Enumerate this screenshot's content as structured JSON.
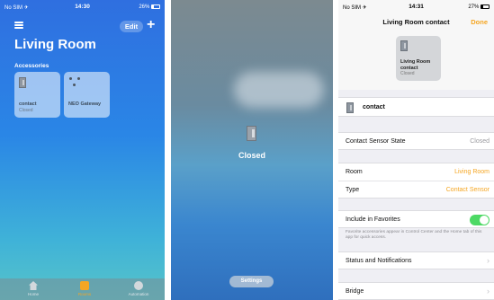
{
  "left": {
    "status": {
      "carrier": "No SIM ✈",
      "time": "14:30",
      "battery": "26%",
      "battery_level": 0.26
    },
    "edit_label": "Edit",
    "plus_label": "+",
    "room_title": "Living Room",
    "section_label": "Accessories",
    "tiles": [
      {
        "name": "contact",
        "state": "Closed"
      },
      {
        "name": "NEO Gateway",
        "state": ""
      }
    ],
    "tabs": [
      {
        "label": "Home",
        "icon": "house-icon"
      },
      {
        "label": "Rooms",
        "icon": "rooms-icon"
      },
      {
        "label": "Automation",
        "icon": "automation-icon"
      }
    ]
  },
  "middle": {
    "state": "Closed",
    "settings_label": "Settings"
  },
  "right": {
    "status": {
      "carrier": "No SIM ✈",
      "time": "14:31",
      "battery": "27%",
      "battery_level": 0.27
    },
    "nav_title": "Living Room contact",
    "done_label": "Done",
    "hero": {
      "name": "Living Room contact",
      "state": "Closed"
    },
    "accessory_name": "contact",
    "rows": {
      "sensor_state": {
        "label": "Contact Sensor State",
        "value": "Closed"
      },
      "room": {
        "label": "Room",
        "value": "Living Room"
      },
      "type": {
        "label": "Type",
        "value": "Contact Sensor"
      },
      "favorites": {
        "label": "Include in Favorites",
        "on": true
      },
      "favorites_note": "Favorite accessories appear in Control Center and the Home tab of this app for quick access.",
      "status": {
        "label": "Status and Notifications"
      },
      "bridge": {
        "label": "Bridge"
      }
    },
    "accent_color": "#f5a623",
    "toggle_color": "#4cd964"
  }
}
